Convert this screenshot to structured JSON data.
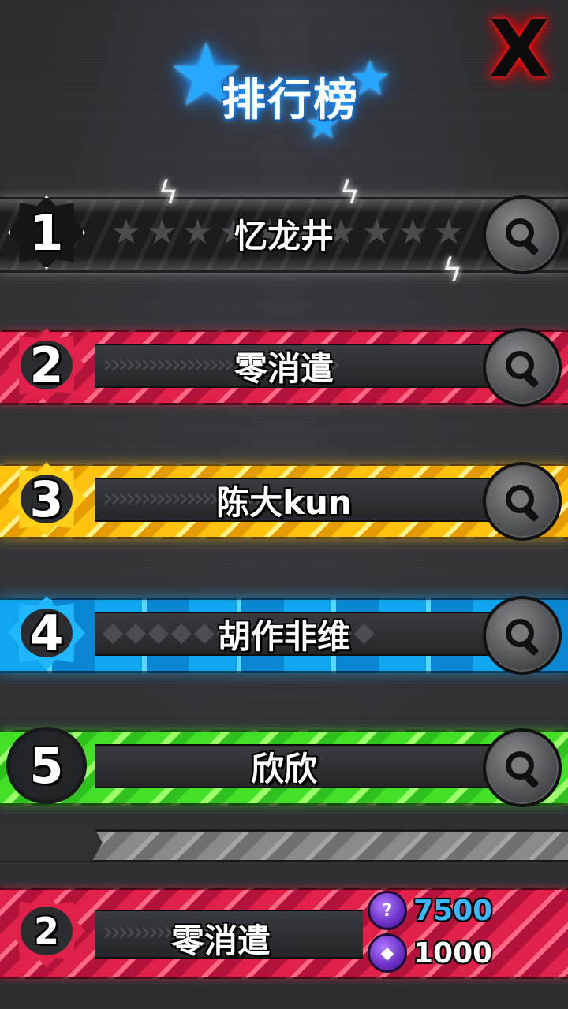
{
  "title": "排行榜",
  "close_label": "X",
  "leaderboard": [
    {
      "rank": "1",
      "name": "忆龙井",
      "theme": "dark"
    },
    {
      "rank": "2",
      "name": "零消遣",
      "theme": "red"
    },
    {
      "rank": "3",
      "name": "陈大kun",
      "theme": "yellow"
    },
    {
      "rank": "4",
      "name": "胡作非维",
      "theme": "blue"
    },
    {
      "rank": "5",
      "name": "欣欣",
      "theme": "green"
    }
  ],
  "my_entry": {
    "rank": "2",
    "name": "零消遣",
    "currency_1": {
      "icon": "gem-icon",
      "amount": "7500",
      "color": "#3ab8ff"
    },
    "currency_2": {
      "icon": "crystal-icon",
      "amount": "1000",
      "color": "#ffffff"
    }
  },
  "colors": {
    "red": "#e0214a",
    "yellow": "#ffc20e",
    "blue": "#10a6ef",
    "green": "#44e028",
    "title_glow": "#2aa7ff",
    "close": "#ff2020"
  }
}
